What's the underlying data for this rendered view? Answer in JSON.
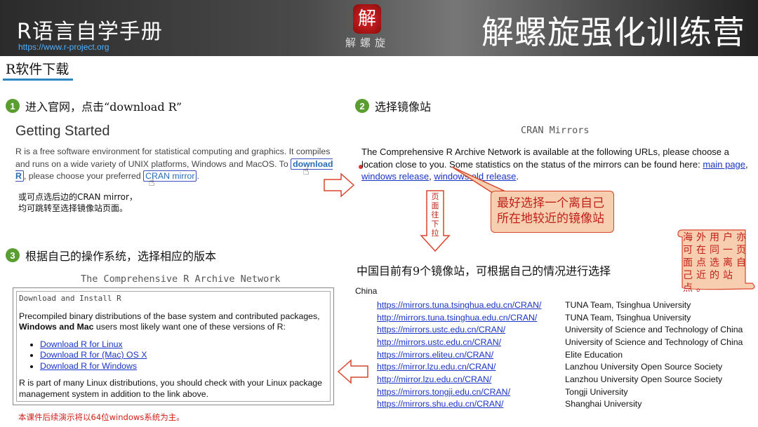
{
  "header": {
    "title": "R语言自学手册",
    "url": "https://www.r-project.org",
    "seal_char": "解",
    "seal_text": "解螺旋",
    "brand": "解螺旋强化训练营"
  },
  "section_title": "R软件下载",
  "step1": {
    "num": "1",
    "text": "进入官网，点击“download R”"
  },
  "step2": {
    "num": "2",
    "text": "选择镜像站"
  },
  "step3": {
    "num": "3",
    "text": "根据自己的操作系统，选择相应的版本"
  },
  "getting_started": {
    "title": "Getting Started",
    "text_a": "R is a free software environment for statistical computing and graphics. It compiles and runs on a wide variety of UNIX platforms, Windows and MacOS. To ",
    "download_link": "download R",
    "text_b": ", please choose your preferred ",
    "cran_link": "CRAN mirror",
    "text_c": "."
  },
  "note1_line1": "或可点选后边的CRAN mirror，",
  "note1_line2": "均可跳转至选择镜像站页面。",
  "cran": {
    "title": "CRAN Mirrors",
    "text_a": "The Comprehensive R Archive Network is available at the following URLs, please choose a location close to you. Some statistics on the status of the mirrors can be found here: ",
    "link1": "main page",
    "sep1": ", ",
    "link2": "windows release",
    "sep2": ", ",
    "link3": "windows old release",
    "end": "."
  },
  "callout_line1": "最好选择一个离自己",
  "callout_line2": "所在地较近的镜像站",
  "scroll_down_label": "页面往下拉",
  "scroll_note": "海外用户亦可在同一页面点选离自己近的站点。",
  "mirror_head": "中国目前有9个镜像站，可根据自己的情况进行选择",
  "china_label": "China",
  "mirrors": [
    {
      "url": "https://mirrors.tuna.tsinghua.edu.cn/CRAN/",
      "name": "TUNA Team, Tsinghua University"
    },
    {
      "url": "http://mirrors.tuna.tsinghua.edu.cn/CRAN/",
      "name": "TUNA Team, Tsinghua University"
    },
    {
      "url": "https://mirrors.ustc.edu.cn/CRAN/",
      "name": "University of Science and Technology of China"
    },
    {
      "url": "http://mirrors.ustc.edu.cn/CRAN/",
      "name": "University of Science and Technology of China"
    },
    {
      "url": "https://mirrors.eliteu.cn/CRAN/",
      "name": "Elite Education"
    },
    {
      "url": "https://mirror.lzu.edu.cn/CRAN/",
      "name": "Lanzhou University Open Source Society"
    },
    {
      "url": "http://mirror.lzu.edu.cn/CRAN/",
      "name": "Lanzhou University Open Source Society"
    },
    {
      "url": "https://mirrors.tongji.edu.cn/CRAN/",
      "name": "Tongji University"
    },
    {
      "url": "https://mirrors.shu.edu.cn/CRAN/",
      "name": "Shanghai University"
    }
  ],
  "rcn_title": "The Comprehensive R Archive Network",
  "download_box": {
    "heading": "Download and Install R",
    "intro_a": "Precompiled binary distributions of the base system and contributed packages, ",
    "intro_bold": "Windows and Mac",
    "intro_b": " users most likely want one of these versions of R:",
    "links": [
      "Download R for Linux",
      "Download R for (Mac) OS X",
      "Download R for Windows"
    ],
    "outro": "R is part of many Linux distributions, you should check with your Linux package management system in addition to the link above."
  },
  "footnote": "本课件后续演示将以64位windows系统为主。",
  "colors": {
    "accent_green": "#5a9e32",
    "note_red": "#c0201a",
    "link_blue": "#1a33c8",
    "callout_fill": "#f7cfb0"
  }
}
